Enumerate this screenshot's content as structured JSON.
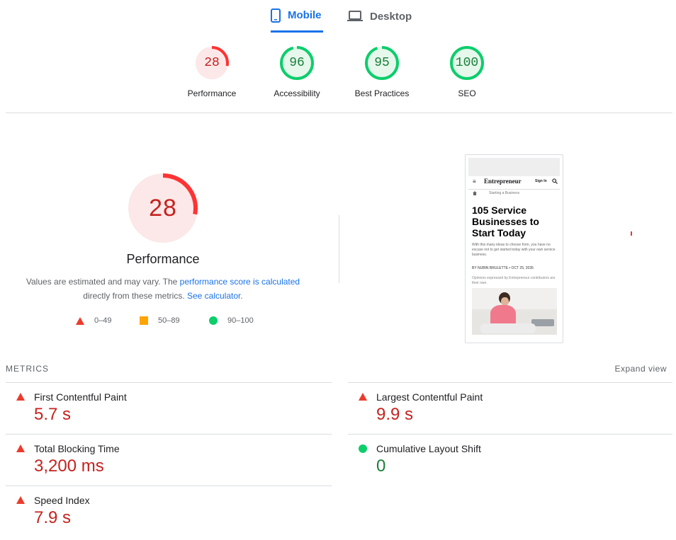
{
  "tabs": [
    {
      "label": "Mobile",
      "active": true
    },
    {
      "label": "Desktop",
      "active": false
    }
  ],
  "categories": [
    {
      "score": "28",
      "label": "Performance",
      "fraction": 0.28,
      "status": "fail"
    },
    {
      "score": "96",
      "label": "Accessibility",
      "fraction": 0.96,
      "status": "pass"
    },
    {
      "score": "95",
      "label": "Best Practices",
      "fraction": 0.95,
      "status": "pass"
    },
    {
      "score": "100",
      "label": "SEO",
      "fraction": 1.0,
      "status": "pass"
    }
  ],
  "performance": {
    "score": "28",
    "fraction": 0.28,
    "title": "Performance",
    "desc_prefix": "Values are estimated and may vary. The ",
    "desc_link1": "performance score is calculated",
    "desc_middle": "directly from these metrics. ",
    "desc_link2": "See calculator",
    "desc_suffix": "."
  },
  "legend": [
    {
      "range": "0–49",
      "shape": "triangle",
      "color": "#eb3b2c"
    },
    {
      "range": "50–89",
      "shape": "square",
      "color": "#ffa400"
    },
    {
      "range": "90–100",
      "shape": "circle",
      "color": "#0cce6b"
    }
  ],
  "preview": {
    "logo": "Entrepreneur",
    "sign_in": "Sign In",
    "breadcrumb": "Starting a Business",
    "headline": "105 Service Businesses to Start Today",
    "intro": "With this many ideas to choose from, you have no excuse not to get started today with your own service business.",
    "byline": "BY NUBIN BRULETTE • OCT 25, 2035",
    "note": "Opinions expressed by Entrepreneur contributors are their own."
  },
  "metrics": {
    "title": "METRICS",
    "expand": "Expand view",
    "items": [
      {
        "name": "First Contentful Paint",
        "value": "5.7 s",
        "status": "fail"
      },
      {
        "name": "Largest Contentful Paint",
        "value": "9.9 s",
        "status": "fail"
      },
      {
        "name": "Total Blocking Time",
        "value": "3,200 ms",
        "status": "fail"
      },
      {
        "name": "Cumulative Layout Shift",
        "value": "0",
        "status": "pass"
      },
      {
        "name": "Speed Index",
        "value": "7.9 s",
        "status": "fail"
      }
    ]
  },
  "colors": {
    "accent": "#1a73e8",
    "fail": "#c5221f",
    "fail_icon": "#eb3b2c",
    "fail_ring": "#ff3333",
    "fail_bg": "#fce8e8",
    "pass": "#188038",
    "pass_ring": "#0cce6b",
    "pass_bg": "#e6f7ec"
  }
}
